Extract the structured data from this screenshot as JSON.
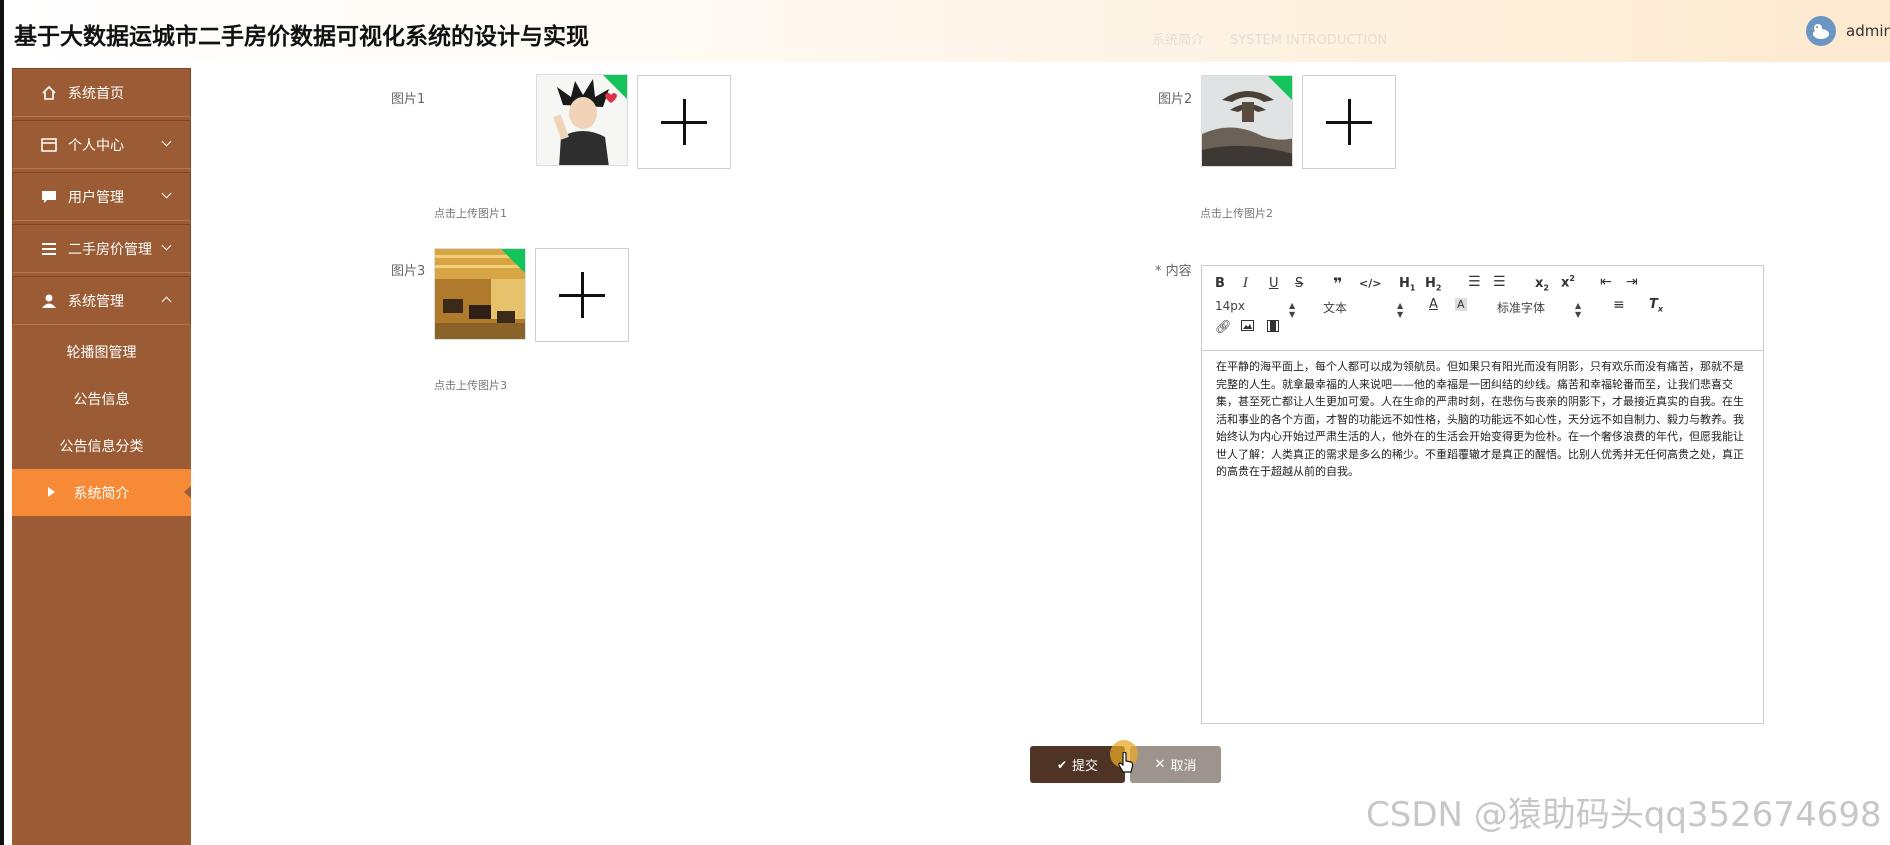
{
  "header": {
    "title": "基于大数据运城市二手房价数据可视化系统的设计与实现",
    "tabs": [
      "系统简介",
      "SYSTEM INTRODUCTION"
    ],
    "username": "admin"
  },
  "sidebar": {
    "items": [
      {
        "label": "系统首页",
        "icon": "home-icon"
      },
      {
        "label": "个人中心",
        "icon": "profile-card-icon",
        "expandable": true
      },
      {
        "label": "用户管理",
        "icon": "chat-icon",
        "expandable": true
      },
      {
        "label": "二手房价管理",
        "icon": "list-icon",
        "expandable": true
      },
      {
        "label": "系统管理",
        "icon": "user-icon",
        "expanded": true
      }
    ],
    "sub_items": [
      {
        "label": "轮播图管理"
      },
      {
        "label": "公告信息"
      },
      {
        "label": "公告信息分类"
      },
      {
        "label": "系统简介",
        "active": true
      }
    ]
  },
  "form": {
    "picture1_label": "图片1",
    "picture1_hint": "点击上传图片1",
    "picture2_label": "图片2",
    "picture2_hint": "点击上传图片2",
    "picture3_label": "图片3",
    "picture3_hint": "点击上传图片3",
    "content_label": "* 内容"
  },
  "editor": {
    "font_size": "14px",
    "paragraph_type": "文本",
    "font_family": "标准字体",
    "content": "在平静的海平面上，每个人都可以成为领航员。但如果只有阳光而没有阴影，只有欢乐而没有痛苦，那就不是完整的人生。就拿最幸福的人来说吧——他的幸福是一团纠结的纱线。痛苦和幸福轮番而至，让我们悲喜交集，甚至死亡都让人生更加可爱。人在生命的严肃时刻，在悲伤与丧亲的阴影下，才最接近真实的自我。在生活和事业的各个方面，才智的功能远不如性格，头脑的功能远不如心性，天分远不如自制力、毅力与教养。我始终认为内心开始过严肃生活的人，他外在的生活会开始变得更为俭朴。在一个奢侈浪费的年代，但愿我能让世人了解：人类真正的需求是多么的稀少。不重蹈覆辙才是真正的醒悟。比别人优秀并无任何高贵之处，真正的高贵在于超越从前的自我。"
  },
  "buttons": {
    "submit": "提交",
    "cancel": "取消"
  },
  "watermark": "CSDN @猿助码头qq352674698",
  "colors": {
    "sidebar_bg": "#9b5b34",
    "active_item": "#f68a36",
    "submit_bg": "#4f3325",
    "cancel_bg": "#9d958d"
  }
}
